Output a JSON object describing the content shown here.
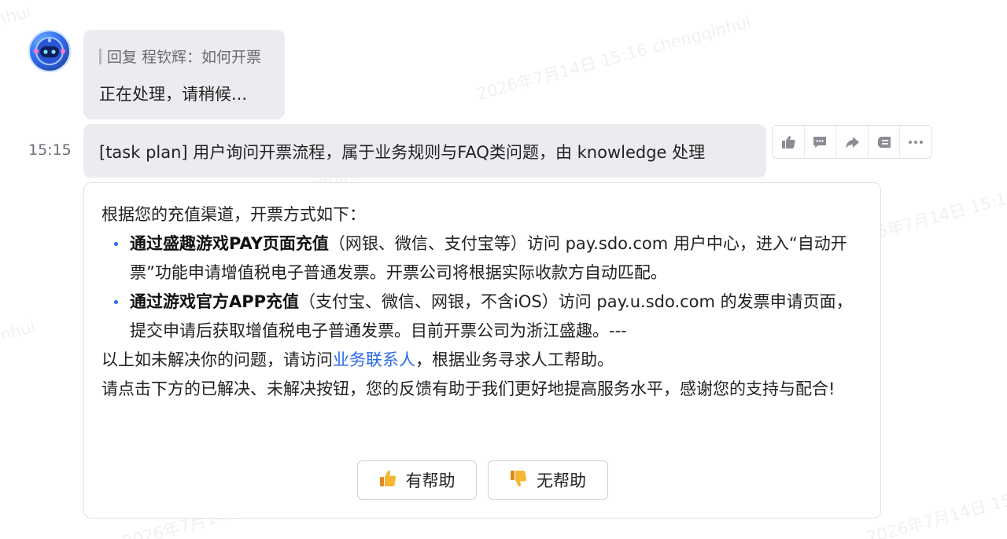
{
  "watermark": {
    "text": "2026年7月14日 15:16 chengqinhui",
    "fragments": [
      "nhui",
      "2026年7月14日 15:16 chengqinhui",
      "5:16 chengqinhui",
      "2026年7月14日 15:16",
      "16 chengqinhui",
      "inhui",
      "2026年7月14日 15:16 chengqinhui",
      "2026年7月14日 15:16"
    ]
  },
  "reply_bubble": {
    "quote": "回复 程钦辉：如何开票",
    "text": "正在处理，请稍候..."
  },
  "message_time": "15:15",
  "plan_bubble": {
    "text": "[task plan] 用户询问开票流程，属于业务规则与FAQ类问题，由 knowledge 处理"
  },
  "toolbar": {
    "icons": [
      "thumbs-up-icon",
      "comment-icon",
      "share-icon",
      "quote-icon",
      "more-icon"
    ]
  },
  "answer": {
    "intro": "根据您的充值渠道，开票方式如下：",
    "bullets": [
      {
        "bold": "通过盛趣游戏PAY页面充值",
        "text": "（网银、微信、支付宝等）访问 pay.sdo.com 用户中心，进入“自动开票”功能申请增值税电子普通发票。开票公司将根据实际收款方自动匹配。"
      },
      {
        "bold": "通过游戏官方APP充值",
        "text": "（支付宝、微信、网银，不含iOS）访问 pay.u.sdo.com 的发票申请页面，提交申请后获取增值税电子普通发票。目前开票公司为浙江盛趣。---"
      }
    ],
    "contact_prefix": "以上如未解决你的问题，请访问",
    "contact_link": "业务联系人",
    "contact_suffix": "，根据业务寻求人工帮助。",
    "feedback_prompt": "请点击下方的已解决、未解决按钮，您的反馈有助于我们更好地提高服务水平，感谢您的支持与配合!",
    "helpful_label": "有帮助",
    "unhelpful_label": "无帮助",
    "helpful_emoji": "👍",
    "unhelpful_emoji": "👎"
  },
  "colors": {
    "bubble_bg": "#ececf0",
    "link": "#2a6ae9",
    "bullet": "#2f6bf0"
  }
}
